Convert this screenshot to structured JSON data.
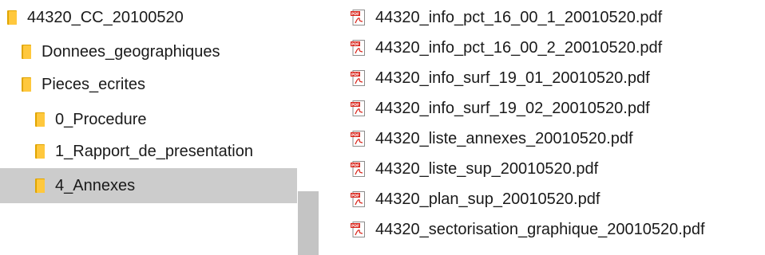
{
  "nav_tree": {
    "items": [
      {
        "label": "44320_CC_20100520",
        "icon": "folder-icon",
        "selected": false
      },
      {
        "label": "Donnees_geographiques",
        "icon": "folder-icon",
        "selected": false
      },
      {
        "label": "Pieces_ecrites",
        "icon": "folder-icon",
        "selected": false
      },
      {
        "label": "0_Procedure",
        "icon": "folder-icon",
        "selected": false
      },
      {
        "label": "1_Rapport_de_presentation",
        "icon": "folder-icon",
        "selected": false
      },
      {
        "label": "4_Annexes",
        "icon": "folder-icon",
        "selected": true
      }
    ]
  },
  "file_list": {
    "files": [
      {
        "name": "44320_info_pct_16_00_1_20010520.pdf",
        "icon": "pdf-file-icon"
      },
      {
        "name": "44320_info_pct_16_00_2_20010520.pdf",
        "icon": "pdf-file-icon"
      },
      {
        "name": "44320_info_surf_19_01_20010520.pdf",
        "icon": "pdf-file-icon"
      },
      {
        "name": "44320_info_surf_19_02_20010520.pdf",
        "icon": "pdf-file-icon"
      },
      {
        "name": "44320_liste_annexes_20010520.pdf",
        "icon": "pdf-file-icon"
      },
      {
        "name": "44320_liste_sup_20010520.pdf",
        "icon": "pdf-file-icon"
      },
      {
        "name": "44320_plan_sup_20010520.pdf",
        "icon": "pdf-file-icon"
      },
      {
        "name": "44320_sectorisation_graphique_20010520.pdf",
        "icon": "pdf-file-icon"
      }
    ]
  },
  "colors": {
    "selection_background": "#cccccc",
    "folder_yellow": "#ffc83d",
    "folder_dark": "#e0a500",
    "pdf_red": "#d9261c",
    "scrollbar_thumb": "#c4c4c4"
  }
}
